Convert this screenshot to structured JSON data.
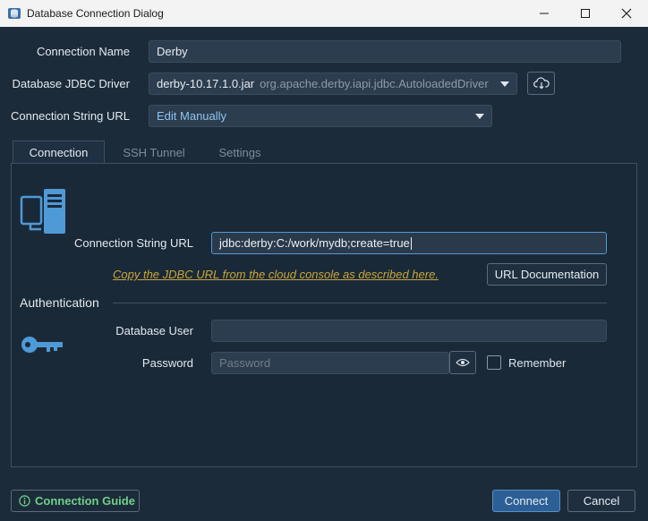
{
  "window": {
    "title": "Database Connection Dialog"
  },
  "form": {
    "connection_name_label": "Connection Name",
    "connection_name_value": "Derby",
    "driver_label": "Database JDBC Driver",
    "driver_jar": "derby-10.17.1.0.jar",
    "driver_class": "org.apache.derby.iapi.jdbc.AutoloadedDriver",
    "conn_string_label": "Connection String URL",
    "conn_string_mode": "Edit Manually"
  },
  "tabs": [
    {
      "label": "Connection",
      "active": true
    },
    {
      "label": "SSH Tunnel",
      "active": false
    },
    {
      "label": "Settings",
      "active": false
    }
  ],
  "connection": {
    "url_label": "Connection String URL",
    "url_value": "jdbc:derby:C:/work/mydb;create=true",
    "copy_link": "Copy the JDBC URL from the cloud console as described here.",
    "url_doc_button": "URL Documentation"
  },
  "auth": {
    "section_title": "Authentication",
    "user_label": "Database User",
    "user_value": "",
    "password_label": "Password",
    "password_placeholder": "Password",
    "remember_label": "Remember"
  },
  "footer": {
    "guide_label": "Connection Guide",
    "connect_label": "Connect",
    "cancel_label": "Cancel"
  },
  "colors": {
    "background": "#1c2b3a",
    "accent": "#4f9ad6",
    "link": "#c9a63a",
    "guide": "#6fd08a"
  }
}
